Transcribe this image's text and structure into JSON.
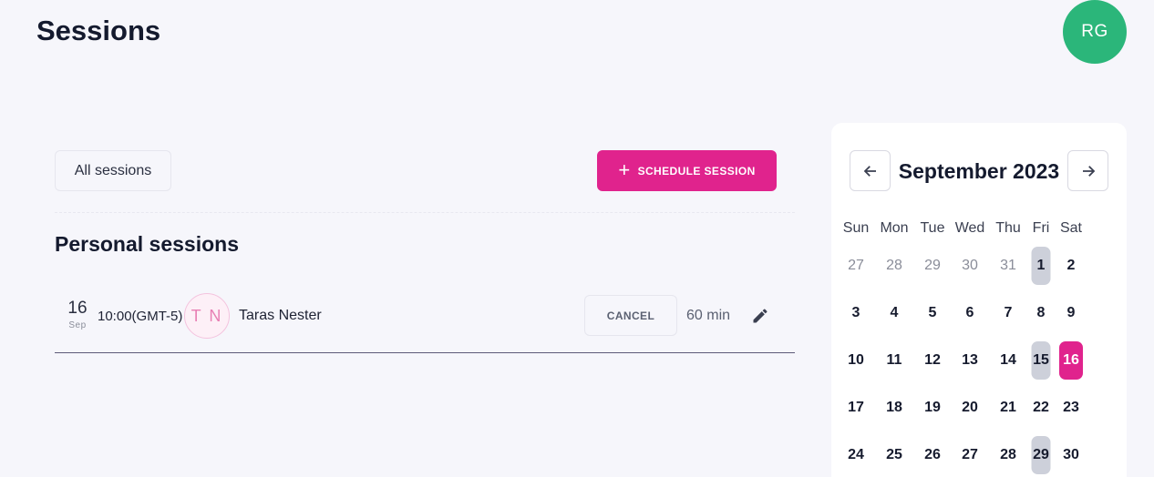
{
  "header": {
    "title": "Sessions",
    "user_initials": "RG"
  },
  "toolbar": {
    "filter_label": "All sessions",
    "schedule_label": "SCHEDULE SESSION"
  },
  "section": {
    "title": "Personal sessions"
  },
  "session": {
    "day": "16",
    "month": "Sep",
    "time": "10:00(GMT-5)",
    "initials": "T N",
    "name": "Taras Nester",
    "cancel_label": "CANCEL",
    "duration": "60 min"
  },
  "calendar": {
    "month_label": "September 2023",
    "weekdays": [
      "Sun",
      "Mon",
      "Tue",
      "Wed",
      "Thu",
      "Fri",
      "Sat"
    ],
    "weeks": [
      [
        "27",
        "28",
        "29",
        "30",
        "31",
        "1",
        "2"
      ],
      [
        "3",
        "4",
        "5",
        "6",
        "7",
        "8",
        "9"
      ],
      [
        "10",
        "11",
        "12",
        "13",
        "14",
        "15",
        "16"
      ],
      [
        "17",
        "18",
        "19",
        "20",
        "21",
        "22",
        "23"
      ],
      [
        "24",
        "25",
        "26",
        "27",
        "28",
        "29",
        "30"
      ]
    ],
    "muted_days": [
      "0-0",
      "0-1",
      "0-2",
      "0-3",
      "0-4"
    ],
    "highlighted_days": [
      "0-5",
      "2-5",
      "4-5"
    ],
    "selected_day": "2-6",
    "colors": {
      "selected": "#e0238d",
      "highlight": "#cdd0da"
    }
  },
  "colors": {
    "accent": "#e0238d",
    "avatar": "#2bb67a",
    "background": "#f6f6fb"
  }
}
